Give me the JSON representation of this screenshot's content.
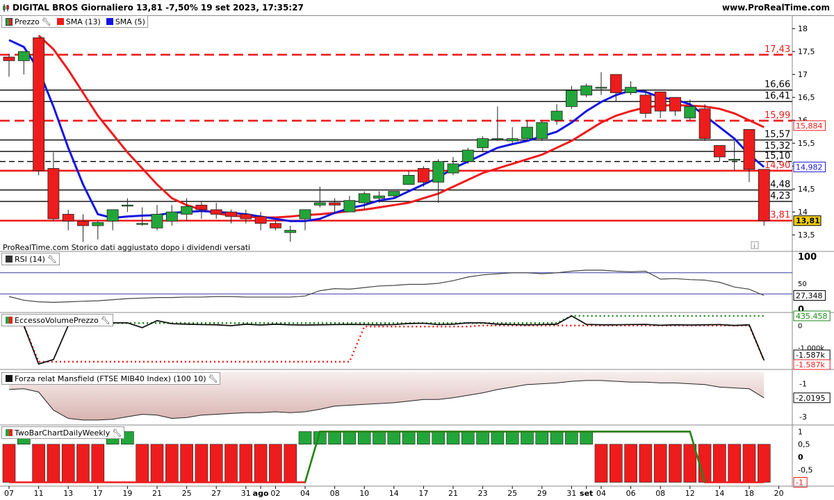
{
  "header": {
    "title": "DIGITAL BROS Giornaliero 13,81 -7,50% 19 set 2023, 17:35:27",
    "site": "www.ProRealTime.com"
  },
  "legends": {
    "price": [
      "Prezzo",
      "SMA (13)",
      "SMA (5)"
    ],
    "rsi": "RSI (14)",
    "volume": "EccessoVolumePrezzo",
    "mansfield": "Forza relat Mansfield (FTSE MIB40 Index) (100 10)",
    "twobar": "TwoBarChartDailyWeekly"
  },
  "note": "ProRealTime.com Storico dati aggiustato dopo i dividendi versati",
  "colors": {
    "up": "#22a63a",
    "down": "#ee1c1c",
    "sma13": "#ee1c1c",
    "sma5": "#1414e0",
    "bg": "#ffffff"
  },
  "chart_data": [
    {
      "type": "candlestick",
      "title": "DIGITAL BROS Giornaliero",
      "x_tick_labels": [
        "07",
        "11",
        "13",
        "17",
        "19",
        "21",
        "25",
        "27",
        "31",
        "ago",
        "02",
        "04",
        "08",
        "10",
        "14",
        "17",
        "21",
        "23",
        "25",
        "29",
        "31",
        "set",
        "04",
        "06",
        "08",
        "12",
        "14",
        "18",
        "20"
      ],
      "y_ticks": [
        "18",
        "17,5",
        "17",
        "16,5",
        "16",
        "15,5",
        "15",
        "14,5",
        "14",
        "13,5"
      ],
      "ylim": [
        13.2,
        18.2
      ],
      "candles": [
        {
          "o": 17.38,
          "h": 17.45,
          "l": 16.95,
          "c": 17.3
        },
        {
          "o": 17.3,
          "h": 17.5,
          "l": 17.0,
          "c": 17.5
        },
        {
          "o": 17.8,
          "h": 17.8,
          "l": 14.8,
          "c": 14.9
        },
        {
          "o": 14.95,
          "h": 15.3,
          "l": 13.8,
          "c": 13.85
        },
        {
          "o": 13.95,
          "h": 14.05,
          "l": 13.6,
          "c": 13.8
        },
        {
          "o": 13.8,
          "h": 13.95,
          "l": 13.35,
          "c": 13.7
        },
        {
          "o": 13.7,
          "h": 13.8,
          "l": 13.4,
          "c": 13.77
        },
        {
          "o": 13.8,
          "h": 14.05,
          "l": 13.6,
          "c": 14.05
        },
        {
          "o": 14.15,
          "h": 14.3,
          "l": 14.0,
          "c": 14.15
        },
        {
          "o": 13.75,
          "h": 14.1,
          "l": 13.7,
          "c": 13.75
        },
        {
          "o": 13.65,
          "h": 14.15,
          "l": 13.6,
          "c": 13.95
        },
        {
          "o": 13.8,
          "h": 14.15,
          "l": 13.7,
          "c": 14.0
        },
        {
          "o": 13.95,
          "h": 14.3,
          "l": 13.8,
          "c": 14.12
        },
        {
          "o": 14.15,
          "h": 14.22,
          "l": 13.85,
          "c": 14.05
        },
        {
          "o": 14.05,
          "h": 14.2,
          "l": 13.85,
          "c": 13.95
        },
        {
          "o": 14.0,
          "h": 14.05,
          "l": 13.75,
          "c": 13.9
        },
        {
          "o": 13.95,
          "h": 14.05,
          "l": 13.75,
          "c": 13.85
        },
        {
          "o": 13.9,
          "h": 14.0,
          "l": 13.6,
          "c": 13.75
        },
        {
          "o": 13.75,
          "h": 13.8,
          "l": 13.6,
          "c": 13.65
        },
        {
          "o": 13.55,
          "h": 13.7,
          "l": 13.35,
          "c": 13.6
        },
        {
          "o": 13.85,
          "h": 14.05,
          "l": 13.6,
          "c": 14.05
        },
        {
          "o": 14.15,
          "h": 14.55,
          "l": 14.1,
          "c": 14.2
        },
        {
          "o": 14.2,
          "h": 14.3,
          "l": 13.95,
          "c": 14.15
        },
        {
          "o": 14.0,
          "h": 14.35,
          "l": 14.0,
          "c": 14.25
        },
        {
          "o": 14.2,
          "h": 14.45,
          "l": 14.05,
          "c": 14.4
        },
        {
          "o": 14.3,
          "h": 14.45,
          "l": 14.2,
          "c": 14.35
        },
        {
          "o": 14.35,
          "h": 14.45,
          "l": 14.3,
          "c": 14.45
        },
        {
          "o": 14.6,
          "h": 14.9,
          "l": 14.6,
          "c": 14.8
        },
        {
          "o": 14.95,
          "h": 15.0,
          "l": 14.55,
          "c": 14.65
        },
        {
          "o": 14.65,
          "h": 15.15,
          "l": 14.2,
          "c": 15.1
        },
        {
          "o": 14.85,
          "h": 15.2,
          "l": 14.8,
          "c": 15.05
        },
        {
          "o": 15.1,
          "h": 15.4,
          "l": 15.05,
          "c": 15.35
        },
        {
          "o": 15.4,
          "h": 15.65,
          "l": 15.3,
          "c": 15.6
        },
        {
          "o": 15.6,
          "h": 16.3,
          "l": 15.55,
          "c": 15.6
        },
        {
          "o": 15.55,
          "h": 15.85,
          "l": 15.5,
          "c": 15.6
        },
        {
          "o": 15.6,
          "h": 16.0,
          "l": 15.55,
          "c": 15.85
        },
        {
          "o": 15.6,
          "h": 16.0,
          "l": 15.55,
          "c": 15.95
        },
        {
          "o": 16.0,
          "h": 16.35,
          "l": 15.9,
          "c": 16.2
        },
        {
          "o": 16.3,
          "h": 16.75,
          "l": 16.25,
          "c": 16.65
        },
        {
          "o": 16.55,
          "h": 16.8,
          "l": 16.5,
          "c": 16.75
        },
        {
          "o": 16.7,
          "h": 17.05,
          "l": 16.55,
          "c": 16.72
        },
        {
          "o": 17.0,
          "h": 17.0,
          "l": 16.4,
          "c": 16.6
        },
        {
          "o": 16.6,
          "h": 16.85,
          "l": 16.55,
          "c": 16.72
        },
        {
          "o": 16.55,
          "h": 16.65,
          "l": 16.05,
          "c": 16.15
        },
        {
          "o": 16.62,
          "h": 16.62,
          "l": 16.05,
          "c": 16.2
        },
        {
          "o": 16.5,
          "h": 16.5,
          "l": 16.1,
          "c": 16.2
        },
        {
          "o": 16.05,
          "h": 16.45,
          "l": 16.0,
          "c": 16.3
        },
        {
          "o": 16.25,
          "h": 16.35,
          "l": 15.55,
          "c": 15.6
        },
        {
          "o": 15.45,
          "h": 15.45,
          "l": 15.1,
          "c": 15.2
        },
        {
          "o": 15.15,
          "h": 15.55,
          "l": 14.9,
          "c": 15.15
        },
        {
          "o": 15.8,
          "h": 15.8,
          "l": 14.65,
          "c": 14.93
        },
        {
          "o": 14.93,
          "h": 14.93,
          "l": 13.7,
          "c": 13.81
        }
      ],
      "series": [
        {
          "name": "SMA (13)",
          "values": [
            null,
            null,
            17.85,
            17.55,
            17.1,
            16.6,
            16.1,
            15.7,
            15.3,
            14.95,
            14.6,
            14.3,
            14.15,
            14.05,
            13.97,
            13.92,
            13.9,
            13.88,
            13.88,
            13.9,
            13.93,
            13.95,
            13.98,
            14.02,
            14.05,
            14.1,
            14.15,
            14.2,
            14.3,
            14.4,
            14.55,
            14.7,
            14.85,
            14.95,
            15.05,
            15.15,
            15.25,
            15.4,
            15.55,
            15.75,
            15.95,
            16.1,
            16.2,
            16.28,
            16.32,
            16.33,
            16.32,
            16.3,
            16.25,
            16.15,
            16.0,
            15.85
          ]
        },
        {
          "name": "SMA (5)",
          "values": [
            17.75,
            17.6,
            17.1,
            16.3,
            15.4,
            14.6,
            13.95,
            13.87,
            13.9,
            13.92,
            13.93,
            13.98,
            14.0,
            14.02,
            14.0,
            13.98,
            13.95,
            13.9,
            13.85,
            13.8,
            13.8,
            13.85,
            13.98,
            14.08,
            14.15,
            14.25,
            14.3,
            14.45,
            14.6,
            14.75,
            14.95,
            15.1,
            15.25,
            15.4,
            15.48,
            15.55,
            15.65,
            15.75,
            15.95,
            16.2,
            16.4,
            16.55,
            16.65,
            16.62,
            16.5,
            16.45,
            16.35,
            16.1,
            15.85,
            15.6,
            15.25,
            14.98
          ]
        }
      ],
      "horizontal_lines": [
        {
          "label": "17,43",
          "value": 17.43,
          "style": "dashed",
          "color": "#ee1c1c"
        },
        {
          "label": "16,66",
          "value": 16.66,
          "style": "solid",
          "color": "#000000"
        },
        {
          "label": "16,41",
          "value": 16.41,
          "style": "solid",
          "color": "#000000"
        },
        {
          "label": "15,99",
          "value": 15.99,
          "style": "dashed",
          "color": "#ee1c1c"
        },
        {
          "label": "15,57",
          "value": 15.57,
          "style": "solid",
          "color": "#000000"
        },
        {
          "label": "15,32",
          "value": 15.32,
          "style": "solid",
          "color": "#000000"
        },
        {
          "label": "15,10",
          "value": 15.1,
          "style": "dashed",
          "color": "#000000"
        },
        {
          "label": "14,90",
          "value": 14.9,
          "style": "solid",
          "color": "#ee1c1c"
        },
        {
          "label": "14,48",
          "value": 14.48,
          "style": "solid",
          "color": "#000000"
        },
        {
          "label": "14,23",
          "value": 14.23,
          "style": "solid",
          "color": "#000000"
        },
        {
          "label": "13,81",
          "value": 13.81,
          "style": "solid",
          "color": "#ee1c1c"
        }
      ],
      "axis_badges": [
        {
          "label": "15,884",
          "value": 15.884,
          "color": "#ee1c1c",
          "fill": "#ffffff"
        },
        {
          "label": "14,982",
          "value": 14.982,
          "color": "#1414e0",
          "fill": "#ffffff"
        },
        {
          "label": "13,81",
          "value": 13.81,
          "color": "#000000",
          "fill": "#f5d000"
        }
      ]
    },
    {
      "type": "line",
      "title": "RSI (14)",
      "y_ticks": [
        "100",
        "50",
        "0"
      ],
      "ylim": [
        0,
        100
      ],
      "levels": [
        70,
        30
      ],
      "badge": "27,348",
      "values": [
        25,
        18,
        15,
        14,
        15,
        16,
        17,
        19,
        21,
        22,
        23,
        23,
        24,
        24,
        25,
        25,
        24,
        24,
        24,
        24,
        26,
        36,
        40,
        39,
        42,
        45,
        46,
        48,
        48,
        50,
        55,
        62,
        66,
        68,
        70,
        70,
        68,
        70,
        73,
        75,
        75,
        73,
        72,
        73,
        58,
        59,
        57,
        56,
        52,
        43,
        39,
        27
      ]
    },
    {
      "type": "line",
      "title": "EccessoVolumePrezzo",
      "y_ticks": [
        "0",
        "-1.000k"
      ],
      "ylim": [
        -2000,
        400
      ],
      "badges": [
        "435.458",
        "-1.587k",
        "-1.587k"
      ],
      "series": [
        {
          "name": "line",
          "values": [
            0,
            0,
            -1750,
            -1550,
            0,
            30,
            80,
            120,
            120,
            -100,
            220,
            80,
            60,
            40,
            30,
            -10,
            60,
            20,
            60,
            30,
            20,
            30,
            40,
            50,
            40,
            30,
            40,
            90,
            100,
            40,
            60,
            120,
            120,
            60,
            40,
            30,
            40,
            60,
            435,
            50,
            30,
            30,
            40,
            50,
            10,
            30,
            20,
            30,
            40,
            0,
            30,
            -1587
          ]
        },
        {
          "name": "signal",
          "values": [
            0,
            0,
            -1650,
            -1650,
            -1650,
            -1650,
            -1650,
            -1650,
            -1650,
            -1650,
            -1650,
            -1650,
            -1650,
            -1650,
            -1650,
            -1650,
            -1650,
            -1650,
            -1650,
            -1650,
            -1650,
            -1650,
            -1650,
            -1650,
            -50,
            -50,
            -50,
            -50,
            -50,
            -50,
            -50,
            -50,
            0,
            0,
            0,
            0,
            0,
            0,
            0,
            0,
            0,
            0,
            0,
            0,
            0,
            0,
            0,
            0,
            0,
            0,
            0,
            -1587
          ]
        },
        {
          "name": "upper",
          "values": [
            110,
            110,
            110,
            110,
            110,
            110,
            110,
            110,
            110,
            110,
            110,
            110,
            110,
            110,
            110,
            110,
            110,
            110,
            110,
            110,
            110,
            110,
            110,
            110,
            110,
            110,
            110,
            110,
            110,
            110,
            110,
            110,
            110,
            110,
            110,
            110,
            110,
            110,
            435,
            435,
            435,
            435,
            435,
            435,
            435,
            435,
            435,
            435,
            435,
            435,
            435,
            435
          ]
        }
      ]
    },
    {
      "type": "area",
      "title": "Forza relat Mansfield (FTSE MIB40 Index) (100 10)",
      "y_ticks": [
        "-1",
        "-3"
      ],
      "ylim": [
        -3.5,
        -0.3
      ],
      "badge": "-2,0195",
      "values": [
        -1.35,
        -1.3,
        -1.5,
        -2.6,
        -3.1,
        -3.2,
        -3.2,
        -3.15,
        -3.0,
        -2.85,
        -2.9,
        -3.1,
        -3.05,
        -2.9,
        -2.85,
        -2.8,
        -2.75,
        -2.75,
        -2.7,
        -2.75,
        -2.7,
        -2.55,
        -2.35,
        -2.3,
        -2.25,
        -2.2,
        -2.15,
        -2.05,
        -1.95,
        -1.95,
        -1.85,
        -1.7,
        -1.55,
        -1.35,
        -1.2,
        -1.05,
        -1.0,
        -0.95,
        -0.85,
        -0.8,
        -0.8,
        -0.85,
        -0.9,
        -0.9,
        -0.95,
        -0.95,
        -1.0,
        -1.05,
        -1.2,
        -1.25,
        -1.3,
        -1.85
      ]
    },
    {
      "type": "bar",
      "title": "TwoBarChartDailyWeekly",
      "y_ticks": [
        "1",
        "0,5",
        "0",
        "-0,5"
      ],
      "ylim": [
        -1.15,
        1.15
      ],
      "badge": "-1",
      "values": [
        -1,
        1,
        -1,
        -1,
        -1,
        -1,
        -1,
        1,
        1,
        -1,
        -1,
        -1,
        -1,
        -1,
        -1,
        -1,
        -1,
        -1,
        -1,
        -1,
        1,
        1,
        1,
        1,
        1,
        1,
        1,
        1,
        1,
        1,
        1,
        1,
        1,
        1,
        1,
        1,
        1,
        1,
        1,
        1,
        -1,
        -1,
        -1,
        -1,
        -1,
        -1,
        -1,
        -1,
        -1,
        -1,
        -1,
        -1
      ],
      "line": [
        -1,
        -1,
        -1,
        -1,
        -1,
        -1,
        -1,
        -1,
        -1,
        -1,
        -1,
        -1,
        -1,
        -1,
        -1,
        -1,
        -1,
        -1,
        -1,
        -1,
        -1,
        1,
        1,
        1,
        1,
        1,
        1,
        1,
        1,
        1,
        1,
        1,
        1,
        1,
        1,
        1,
        1,
        1,
        1,
        1,
        1,
        1,
        1,
        1,
        1,
        1,
        1,
        -1,
        -1,
        -1,
        -1,
        -1
      ]
    }
  ]
}
